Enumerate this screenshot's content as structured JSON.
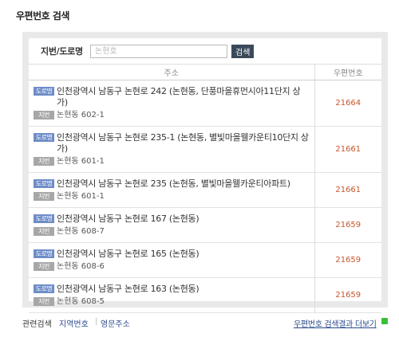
{
  "page_title": "우편번호 검색",
  "search": {
    "label": "지번/도로명",
    "placeholder": "논현호",
    "button": "검색"
  },
  "table": {
    "headers": {
      "address": "주소",
      "zip": "우편번호"
    },
    "rows": [
      {
        "road_badge": "도로명",
        "road": "인천광역시 남동구 논현로 242 (논현동, 단풍마을휴먼시아11단지 상가)",
        "jibun_badge": "지번",
        "jibun": "논현동 602-1",
        "zip": "21664"
      },
      {
        "road_badge": "도로명",
        "road": "인천광역시 남동구 논현로 235-1 (논현동, 별빛마을웰카운티10단지 상가)",
        "jibun_badge": "지번",
        "jibun": "논현동 601-1",
        "zip": "21661"
      },
      {
        "road_badge": "도로명",
        "road": "인천광역시 남동구 논현로 235 (논현동, 별빛마을웰카운티아파트)",
        "jibun_badge": "지번",
        "jibun": "논현동 601-1",
        "zip": "21661"
      },
      {
        "road_badge": "도로명",
        "road": "인천광역시 남동구 논현로 167 (논현동)",
        "jibun_badge": "지번",
        "jibun": "논현동 608-7",
        "zip": "21659"
      },
      {
        "road_badge": "도로명",
        "road": "인천광역시 남동구 논현로 165 (논현동)",
        "jibun_badge": "지번",
        "jibun": "논현동 608-6",
        "zip": "21659"
      },
      {
        "road_badge": "도로명",
        "road": "인천광역시 남동구 논현로 163 (논현동)",
        "jibun_badge": "지번",
        "jibun": "논현동 608-5",
        "zip": "21659"
      }
    ]
  },
  "footer": {
    "related_label": "관련검색",
    "link_region": "지역번호",
    "separator": "|",
    "link_english": "영문주소",
    "more_link": "우편번호 검색결과 더보기",
    "more_icon": "green-square-icon"
  },
  "colors": {
    "zip_text": "#c8562a",
    "road_badge": "#6e8cc8",
    "jibun_badge": "#a7a7a7",
    "search_button": "#3a4a5a",
    "link": "#2b4a8e"
  }
}
